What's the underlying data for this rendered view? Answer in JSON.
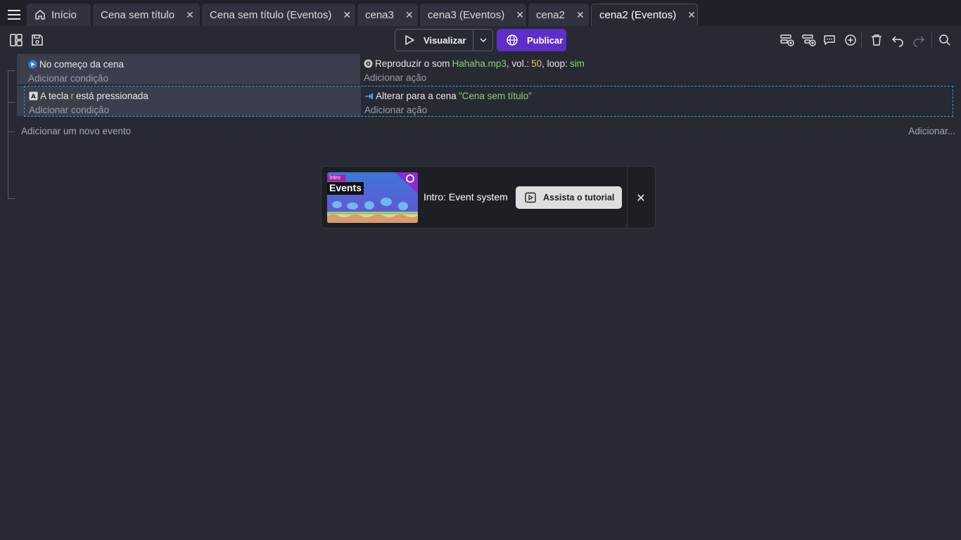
{
  "tabs": [
    {
      "label": "Início",
      "icon": "home-icon",
      "closable": false,
      "active": false
    },
    {
      "label": "Cena sem título",
      "closable": true,
      "active": false
    },
    {
      "label": "Cena sem título (Eventos)",
      "closable": true,
      "active": false
    },
    {
      "label": "cena3",
      "closable": true,
      "active": false
    },
    {
      "label": "cena3 (Eventos)",
      "closable": true,
      "active": false
    },
    {
      "label": "cena2",
      "closable": true,
      "active": false
    },
    {
      "label": "cena2 (Eventos)",
      "closable": true,
      "active": true
    }
  ],
  "tab_close_glyph": "✕",
  "toolbar": {
    "preview_label": "Visualizar",
    "publish_label": "Publicar",
    "accent_color": "#5d2ec9"
  },
  "events": [
    {
      "condition": {
        "icon": "scene-start-icon",
        "text": "No começo da cena"
      },
      "condition_add": "Adicionar condição",
      "action": {
        "icon": "sound-icon",
        "prefix": "Reproduzir o som",
        "file": "Hahaha.mp3",
        "vol_label": ", vol.:",
        "vol": "50",
        "loop_label": ", loop:",
        "loop": "sim"
      },
      "action_add": "Adicionar ação"
    },
    {
      "condition": {
        "icon": "keyboard-key-icon",
        "prefix": "A tecla",
        "key": "r",
        "suffix": "está pressionada"
      },
      "condition_add": "Adicionar condição",
      "action": {
        "icon": "change-scene-icon",
        "prefix": "Alterar para a cena",
        "scene": "\"Cena sem título\""
      },
      "action_add": "Adicionar ação"
    }
  ],
  "add_event_label": "Adicionar um novo evento",
  "add_more_label": "Adicionar...",
  "tutorial": {
    "thumb_badge": "Intro",
    "thumb_title": "Events",
    "title": "Intro: Event system",
    "watch_label": "Assista o tutorial",
    "close_glyph": "✕"
  }
}
